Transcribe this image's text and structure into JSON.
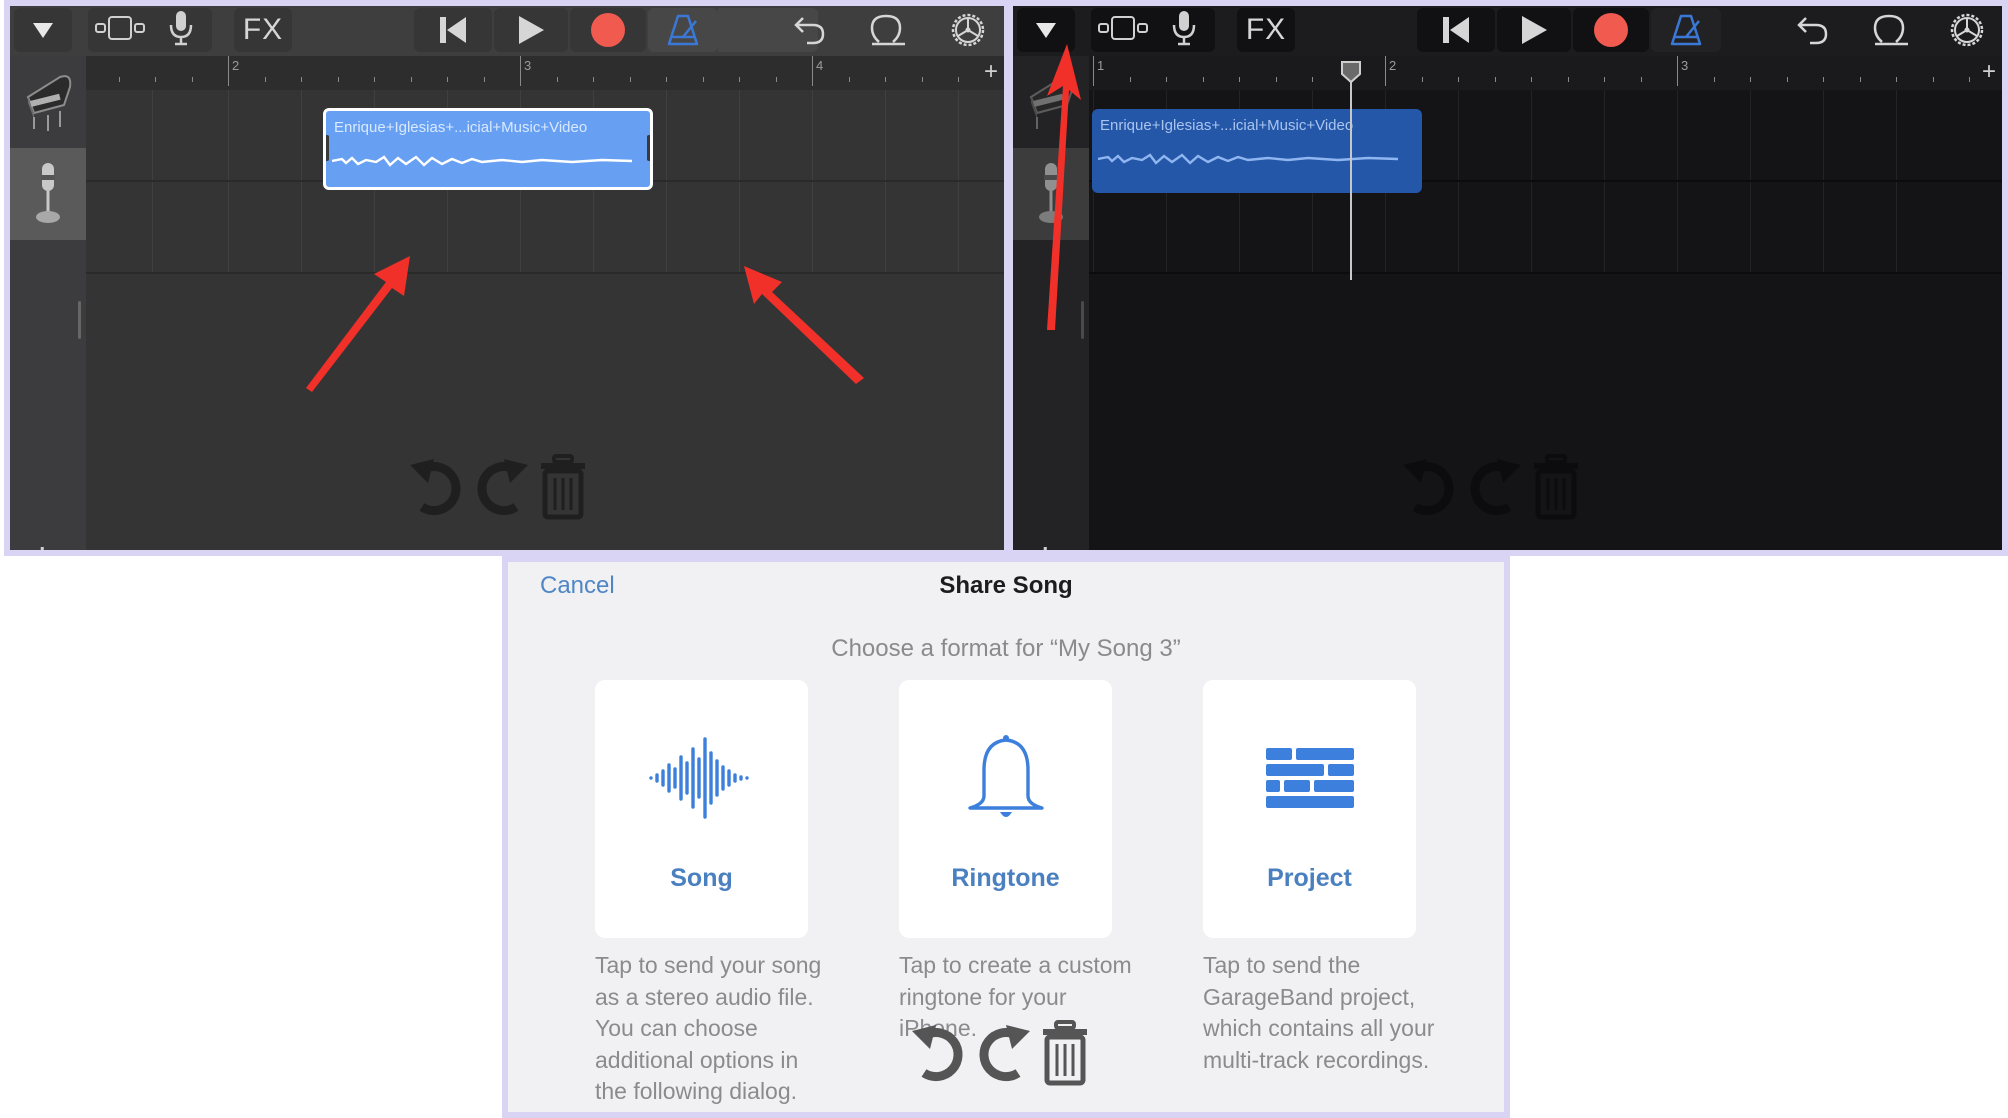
{
  "toolbar": {
    "tracks_menu_icon": "triangle-down-icon",
    "track_view_icon": "track-view-icon",
    "mic_icon": "microphone-icon",
    "fx_label": "FX",
    "rewind_icon": "skip-back-icon",
    "play_icon": "play-icon",
    "record_icon": "record-icon",
    "metronome_icon": "metronome-icon",
    "undo_icon": "undo-icon",
    "loop_icon": "loop-icon",
    "settings_icon": "settings-gear-icon",
    "record_color": "#f05a4f",
    "metronome_color": "#3b78d6"
  },
  "left_panel": {
    "ruler": {
      "bars": [
        "2",
        "3",
        "4"
      ],
      "add_label": "+"
    },
    "tracks": [
      {
        "instrument": "grand-piano",
        "selected": false
      },
      {
        "instrument": "microphone",
        "selected": true
      }
    ],
    "clip": {
      "title": "Enrique+Iglesias+...icial+Music+Video",
      "selected": true
    },
    "add_track_label": "+",
    "edit_tools": [
      "undo-icon",
      "redo-icon",
      "trash-icon"
    ]
  },
  "right_panel": {
    "ruler": {
      "bars": [
        "1",
        "2",
        "3"
      ],
      "add_label": "+"
    },
    "tracks": [
      {
        "instrument": "grand-piano",
        "selected": false
      },
      {
        "instrument": "microphone",
        "selected": true
      }
    ],
    "clip": {
      "title": "Enrique+Iglesias+...icial+Music+Video",
      "selected": false
    },
    "add_track_label": "+",
    "edit_tools": [
      "undo-icon",
      "redo-icon",
      "trash-icon"
    ]
  },
  "annotations": {
    "arrow_color": "#f2302a"
  },
  "share_dialog": {
    "cancel_label": "Cancel",
    "title": "Share Song",
    "subtitle": "Choose a format for “My Song 3”",
    "options": [
      {
        "label": "Song",
        "icon": "waveform-icon",
        "description": "Tap to send your song as a stereo audio file. You can choose additional options in the following dialog."
      },
      {
        "label": "Ringtone",
        "icon": "bell-icon",
        "description": "Tap to create a custom ringtone for your iPhone."
      },
      {
        "label": "Project",
        "icon": "bricks-icon",
        "description": "Tap to send the GarageBand project, which contains all your multi-track recordings."
      }
    ],
    "accent_color": "#3d7fdc"
  }
}
